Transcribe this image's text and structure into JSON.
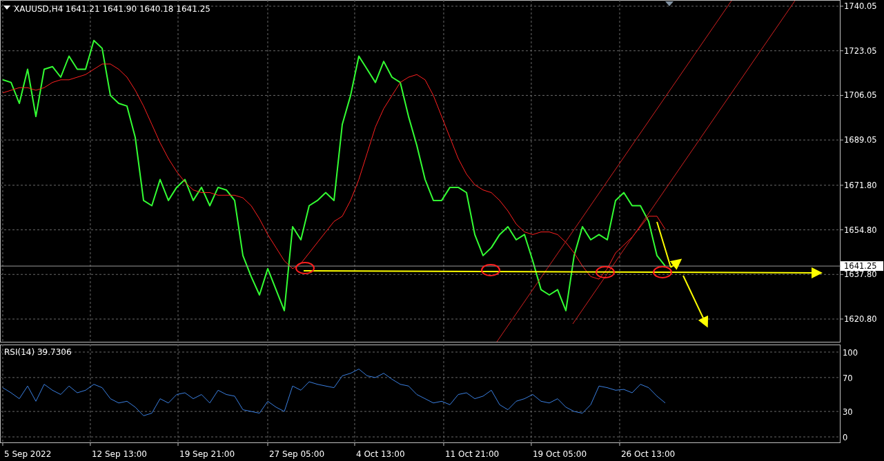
{
  "price_chart": {
    "symbol": "XAUUSD,H4",
    "quotes": [
      "1641.21",
      "1641.90",
      "1640.18",
      "1641.25"
    ],
    "current_price": "1641.25",
    "chart_data": {
      "type": "line",
      "grid": true,
      "ylim": [
        1611.87,
        1742.41
      ],
      "yticks": [
        {
          "value": 1620.8,
          "label": "1620.80"
        },
        {
          "value": 1637.8,
          "label": "1637.80"
        },
        {
          "value": 1654.8,
          "label": "1654.80"
        },
        {
          "value": 1671.8,
          "label": "1671.80"
        },
        {
          "value": 1689.05,
          "label": "1689.05"
        },
        {
          "value": 1706.05,
          "label": "1706.05"
        },
        {
          "value": 1723.05,
          "label": "1723.05"
        },
        {
          "value": 1740.05,
          "label": "1740.05"
        }
      ],
      "series": [
        {
          "color": "#33ff33",
          "values": [
            1712,
            1711,
            1703,
            1716,
            1698,
            1716,
            1717,
            1713,
            1721,
            1716,
            1716,
            1727,
            1724,
            1706,
            1703,
            1702,
            1690,
            1666,
            1664,
            1674,
            1666,
            1671,
            1674,
            1666,
            1671,
            1664,
            1671,
            1670,
            1666,
            1645,
            1637,
            1630,
            1640,
            1632,
            1624,
            1656,
            1651,
            1664,
            1666,
            1669,
            1666,
            1695,
            1706,
            1721,
            1716,
            1711,
            1719,
            1713,
            1711,
            1698,
            1687,
            1674,
            1666,
            1666,
            1671,
            1671,
            1669,
            1653,
            1645,
            1648,
            1653,
            1656,
            1651,
            1653,
            1643,
            1632,
            1630,
            1632,
            1624,
            1645,
            1656,
            1651,
            1653,
            1651,
            1666,
            1669,
            1664,
            1664,
            1658,
            1645,
            1641
          ]
        },
        {
          "color": "#ff2020",
          "values": [
            1707,
            1708,
            1709,
            1709,
            1708,
            1709,
            1711,
            1712,
            1712,
            1713,
            1714,
            1716,
            1718,
            1718,
            1716,
            1713,
            1708,
            1702,
            1695,
            1688,
            1682,
            1677,
            1673,
            1670,
            1669,
            1669,
            1668,
            1668,
            1668,
            1667,
            1664,
            1659,
            1653,
            1648,
            1643,
            1640,
            1642,
            1646,
            1650,
            1654,
            1658,
            1660,
            1666,
            1674,
            1684,
            1694,
            1701,
            1706,
            1711,
            1713,
            1714,
            1712,
            1706,
            1698,
            1690,
            1682,
            1676,
            1672,
            1670,
            1669,
            1666,
            1662,
            1657,
            1654,
            1653,
            1654,
            1654,
            1653,
            1650,
            1646,
            1641,
            1637,
            1636,
            1640,
            1646,
            1649,
            1652,
            1656,
            1660,
            1660,
            1655
          ]
        }
      ]
    }
  },
  "rsi_chart": {
    "label": "RSI(14) 39.7306",
    "time_labels": [
      "5 Sep 2022",
      "12 Sep 13:00",
      "19 Sep 21:00",
      "27 Sep 05:00",
      "4 Oct 13:00",
      "11 Oct 21:00",
      "19 Oct 05:00",
      "26 Oct 13:00"
    ],
    "chart_data": {
      "type": "line",
      "grid": true,
      "ylim": [
        -7.3,
        108.9
      ],
      "yticks": [
        0,
        30,
        70,
        100
      ],
      "series": [
        {
          "color": "#3a7fe0",
          "values": [
            58,
            52,
            45,
            60,
            42,
            62,
            55,
            50,
            60,
            52,
            55,
            62,
            58,
            45,
            40,
            42,
            35,
            25,
            28,
            45,
            40,
            50,
            52,
            45,
            50,
            40,
            55,
            50,
            48,
            32,
            30,
            28,
            42,
            35,
            30,
            60,
            55,
            65,
            62,
            60,
            58,
            72,
            75,
            80,
            72,
            70,
            75,
            68,
            62,
            60,
            50,
            45,
            40,
            42,
            38,
            50,
            52,
            45,
            48,
            55,
            38,
            32,
            42,
            45,
            50,
            42,
            40,
            45,
            35,
            30,
            28,
            38,
            60,
            58,
            55,
            56,
            52,
            62,
            58,
            48,
            40
          ]
        }
      ]
    }
  }
}
